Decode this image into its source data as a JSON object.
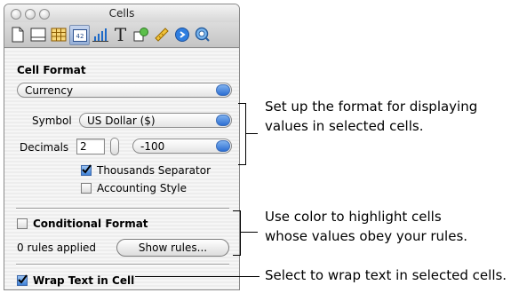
{
  "window": {
    "title": "Cells"
  },
  "toolbar": {
    "icons": [
      "document-icon",
      "layout-icon",
      "table-icon",
      "cells-icon",
      "chart-icon",
      "text-icon",
      "graphic-icon",
      "metrics-icon",
      "hyperlink-icon",
      "quicktime-icon"
    ],
    "cells_icon_text": "42",
    "text_glyph": "T"
  },
  "cell_format": {
    "section_title": "Cell Format",
    "format_value": "Currency",
    "symbol_label": "Symbol",
    "symbol_value": "US Dollar ($)",
    "decimals_label": "Decimals",
    "decimals_value": "2",
    "negative_value": "-100",
    "thousands_label": "Thousands Separator",
    "thousands_checked": true,
    "accounting_label": "Accounting Style",
    "accounting_checked": false
  },
  "conditional_format": {
    "label": "Conditional Format",
    "checked": false,
    "rules_text": "0 rules applied",
    "show_rules_button": "Show rules..."
  },
  "wrap_text": {
    "label": "Wrap Text in Cell",
    "checked": true
  },
  "callouts": {
    "format": [
      "Set up the format for displaying",
      "values in selected cells."
    ],
    "conditional": [
      "Use color to highlight cells",
      "whose values obey your rules."
    ],
    "wrap": "Select to wrap text in selected cells."
  }
}
